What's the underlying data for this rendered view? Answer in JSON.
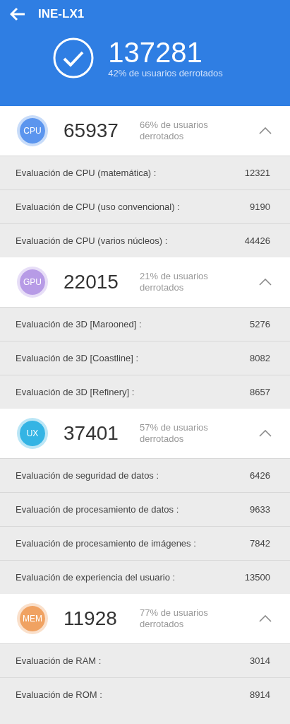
{
  "header": {
    "title": "INE-LX1",
    "score": "137281",
    "subtitle": "42% de usuarios derrotados"
  },
  "sections": [
    {
      "badge": "CPU",
      "color": "#5b95ee",
      "score": "65937",
      "beaten": "66% de usuarios derrotados",
      "expanded": true,
      "rows": [
        {
          "label": "Evaluación de CPU (matemática) :",
          "value": "12321"
        },
        {
          "label": "Evaluación de CPU (uso convencional) :",
          "value": "9190"
        },
        {
          "label": "Evaluación de CPU (varios núcleos) :",
          "value": "44426"
        }
      ]
    },
    {
      "badge": "GPU",
      "color": "#b79be6",
      "score": "22015",
      "beaten": "21% de usuarios derrotados",
      "expanded": true,
      "rows": [
        {
          "label": "Evaluación de 3D [Marooned] :",
          "value": "5276"
        },
        {
          "label": "Evaluación de 3D [Coastline] :",
          "value": "8082"
        },
        {
          "label": "Evaluación de 3D [Refinery] :",
          "value": "8657"
        }
      ]
    },
    {
      "badge": "UX",
      "color": "#34b4e4",
      "score": "37401",
      "beaten": "57% de usuarios derrotados",
      "expanded": true,
      "rows": [
        {
          "label": "Evaluación de seguridad de datos :",
          "value": "6426"
        },
        {
          "label": "Evaluación de procesamiento de datos :",
          "value": "9633"
        },
        {
          "label": "Evaluación de procesamiento de imágenes :",
          "value": "7842"
        },
        {
          "label": "Evaluación de experiencia del usuario :",
          "value": "13500"
        }
      ]
    },
    {
      "badge": "MEM",
      "color": "#f0a262",
      "score": "11928",
      "beaten": "77% de usuarios derrotados",
      "expanded": true,
      "rows": [
        {
          "label": "Evaluación de RAM :",
          "value": "3014"
        },
        {
          "label": "Evaluación de ROM :",
          "value": "8914"
        }
      ]
    }
  ]
}
